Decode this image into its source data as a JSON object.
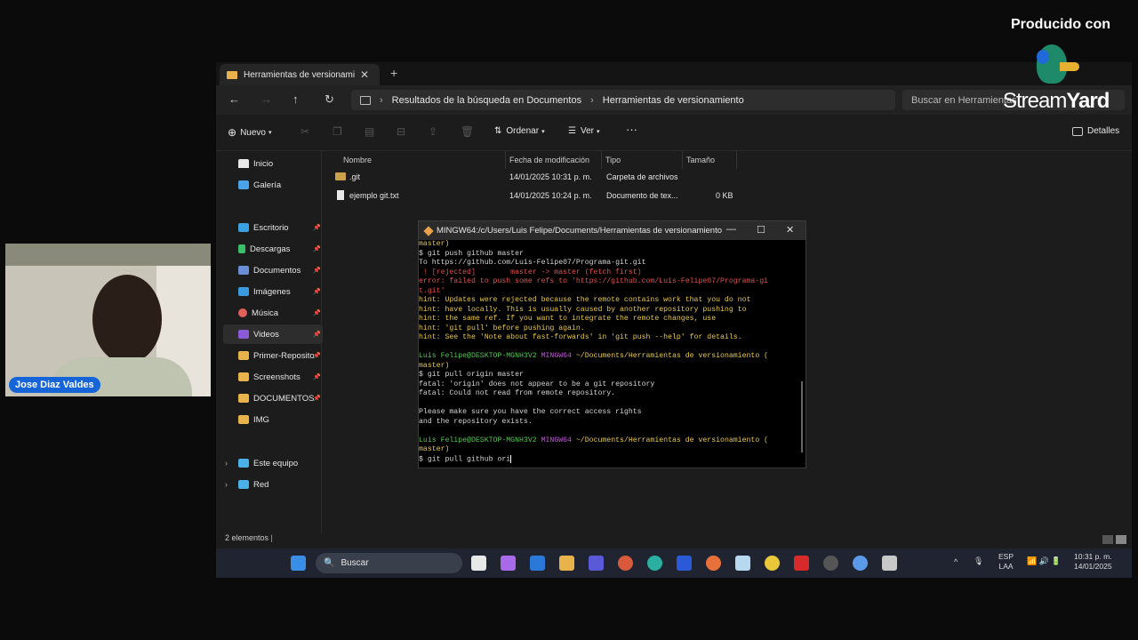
{
  "branding": {
    "produced_with": "Producido con",
    "logo_stream": "Stream",
    "logo_yard": "Yard"
  },
  "presenter": {
    "name": "Jose Diaz Valdes"
  },
  "explorer": {
    "tab_title": "Herramientas de versionamier",
    "breadcrumb": [
      "Resultados de la búsqueda en Documentos",
      "Herramientas de versionamiento"
    ],
    "search_placeholder": "Buscar en Herramientas",
    "toolbar": {
      "new": "Nuevo",
      "sort": "Ordenar",
      "view": "Ver",
      "more": "···",
      "details": "Detalles"
    },
    "sidebar": [
      {
        "label": "Inicio"
      },
      {
        "label": "Galería"
      },
      {
        "label": "Escritorio"
      },
      {
        "label": "Descargas"
      },
      {
        "label": "Documentos"
      },
      {
        "label": "Imágenes"
      },
      {
        "label": "Música"
      },
      {
        "label": "Videos"
      },
      {
        "label": "Primer-Reposito"
      },
      {
        "label": "Screenshots"
      },
      {
        "label": "DOCUMENTOS"
      },
      {
        "label": "IMG"
      },
      {
        "label": "Este equipo"
      },
      {
        "label": "Red"
      }
    ],
    "columns": [
      "Nombre",
      "Fecha de modificación",
      "Tipo",
      "Tamaño"
    ],
    "files": [
      {
        "name": ".git",
        "modified": "14/01/2025 10:31 p. m.",
        "type": "Carpeta de archivos",
        "size": ""
      },
      {
        "name": "ejemplo git.txt",
        "modified": "14/01/2025 10:24 p. m.",
        "type": "Documento de tex...",
        "size": "0 KB"
      }
    ],
    "status": "2 elementos"
  },
  "terminal": {
    "title": "MINGW64:/c/Users/Luis Felipe/Documents/Herramientas de versionamiento",
    "lines": [
      {
        "c": "y",
        "t": "master)"
      },
      {
        "c": "w",
        "t": "$ git push github master"
      },
      {
        "c": "w",
        "t": "To https://github.com/Luis-Felipe07/Programa-git.git"
      },
      {
        "c": "r",
        "t": " ! [rejected]        master -> master (fetch first)"
      },
      {
        "c": "r",
        "t": "error: failed to push some refs to 'https://github.com/Luis-Felipe07/Programa-gi"
      },
      {
        "c": "r",
        "t": "t.git'"
      },
      {
        "c": "y",
        "t": "hint: Updates were rejected because the remote contains work that you do not"
      },
      {
        "c": "y",
        "t": "hint: have locally. This is usually caused by another repository pushing to"
      },
      {
        "c": "y",
        "t": "hint: the same ref. If you want to integrate the remote changes, use"
      },
      {
        "c": "y",
        "t": "hint: 'git pull' before pushing again."
      },
      {
        "c": "y",
        "t": "hint: See the 'Note about fast-forwards' in 'git push --help' for details."
      },
      {
        "c": "w",
        "t": ""
      },
      {
        "c": "p",
        "t": "Luis Felipe@DESKTOP-MGNH3V2 MINGW64 ~/Documents/Herramientas de versionamiento ("
      },
      {
        "c": "y",
        "t": "master)"
      },
      {
        "c": "w",
        "t": "$ git pull origin master"
      },
      {
        "c": "w",
        "t": "fatal: 'origin' does not appear to be a git repository"
      },
      {
        "c": "w",
        "t": "fatal: Could not read from remote repository."
      },
      {
        "c": "w",
        "t": ""
      },
      {
        "c": "w",
        "t": "Please make sure you have the correct access rights"
      },
      {
        "c": "w",
        "t": "and the repository exists."
      },
      {
        "c": "w",
        "t": ""
      },
      {
        "c": "p",
        "t": "Luis Felipe@DESKTOP-MGNH3V2 MINGW64 ~/Documents/Herramientas de versionamiento ("
      },
      {
        "c": "y",
        "t": "master)"
      },
      {
        "c": "w",
        "t": "$ git pull github ori"
      }
    ]
  },
  "taskbar": {
    "search": "Buscar",
    "lang1": "ESP",
    "lang2": "LAA",
    "time": "10:31 p. m.",
    "date": "14/01/2025"
  }
}
